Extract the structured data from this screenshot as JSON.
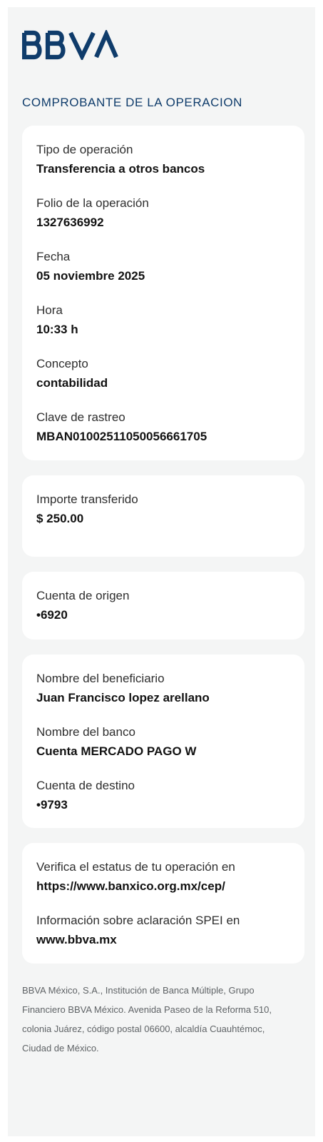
{
  "brand": {
    "logo_text": "BBVA",
    "color": "#0f3c6b"
  },
  "header": {
    "title": "COMPROBANTE DE LA OPERACION"
  },
  "operation": {
    "type_label": "Tipo de operación",
    "type_value": "Transferencia a otros bancos",
    "folio_label": "Folio de la operación",
    "folio_value": "1327636992",
    "date_label": "Fecha",
    "date_value": "05 noviembre 2025",
    "time_label": "Hora",
    "time_value": "10:33 h",
    "concept_label": "Concepto",
    "concept_value": "contabilidad",
    "tracking_label": "Clave de rastreo",
    "tracking_value": "MBAN01002511050056661705"
  },
  "amount": {
    "label": "Importe transferido",
    "value": "$ 250.00"
  },
  "origin": {
    "label": "Cuenta de origen",
    "value": "•6920"
  },
  "beneficiary": {
    "name_label": "Nombre del beneficiario",
    "name_value": "Juan Francisco lopez arellano",
    "bank_label": "Nombre del banco",
    "bank_value": "Cuenta MERCADO PAGO W",
    "account_label": "Cuenta de destino",
    "account_value": "•9793"
  },
  "verify": {
    "status_label": "Verifica el estatus de tu operación en",
    "status_link": "https://www.banxico.org.mx/cep/",
    "spei_label": "Información sobre aclaración SPEI en",
    "spei_link": "www.bbva.mx"
  },
  "footer": {
    "legal_text": "BBVA México, S.A., Institución de Banca Múltiple, Grupo Financiero BBVA México. Avenida Paseo de la Reforma 510, colonia Juárez, código postal 06600, alcaldía Cuauhtémoc, Ciudad de México."
  },
  "colors": {
    "page_background": "#f4f5f5",
    "card_background": "#ffffff",
    "title_blue": "#0f3c6b",
    "footer_gray": "#5f6366"
  }
}
